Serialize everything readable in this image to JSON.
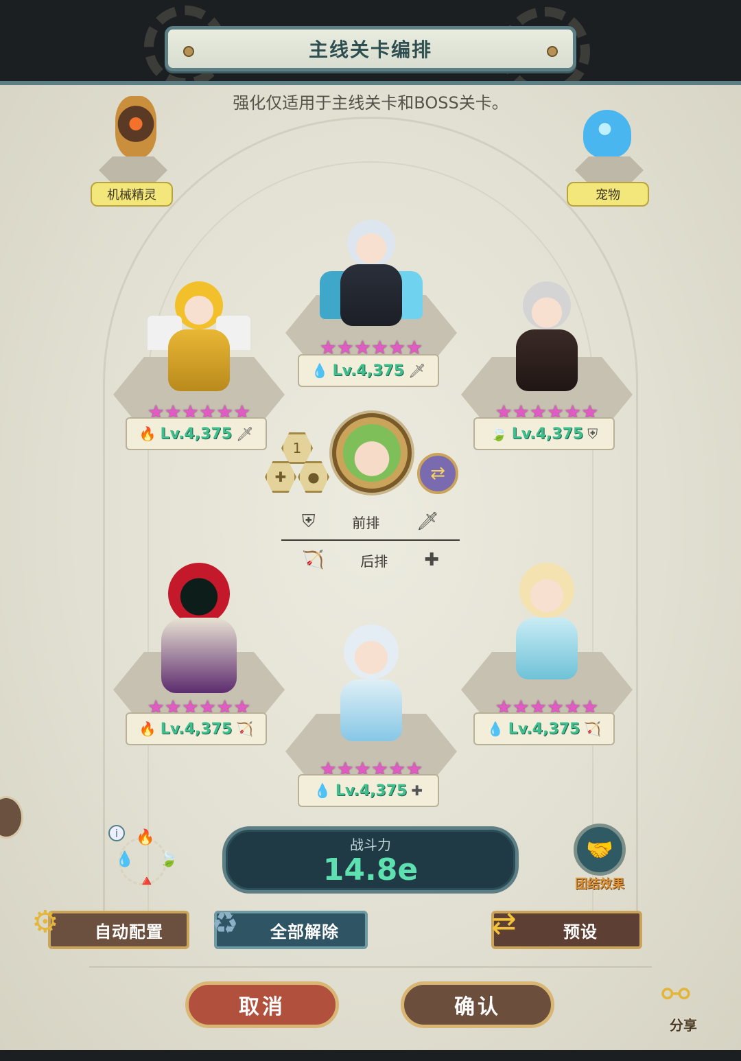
{
  "header": {
    "title": "主线关卡编排"
  },
  "subtitle": "强化仅适用于主线关卡和BOSS关卡。",
  "side_slots": {
    "mech_label": "机械精灵",
    "pet_label": "宠物"
  },
  "heroes": {
    "top_center": {
      "stars": "★★★★★★",
      "element": "💧",
      "level": "Lv.4,375",
      "role_icon": "sword-icon",
      "role": "🗡"
    },
    "front_left": {
      "stars": "★★★★★★",
      "element": "🔥",
      "level": "Lv.4,375",
      "role_icon": "sword-icon",
      "role": "🗡"
    },
    "front_right": {
      "stars": "★★★★★★",
      "element": "🍃",
      "level": "Lv.4,375",
      "role_icon": "shield-icon",
      "role": "⛨"
    },
    "back_left": {
      "stars": "★★★★★★",
      "element": "🔥",
      "level": "Lv.4,375",
      "role_icon": "crossbow-icon",
      "role": "🏹"
    },
    "back_right": {
      "stars": "★★★★★★",
      "element": "💧",
      "level": "Lv.4,375",
      "role_icon": "crossbow-icon",
      "role": "🏹"
    },
    "bottom_center": {
      "stars": "★★★★★★",
      "element": "💧",
      "level": "Lv.4,375",
      "role_icon": "plus-icon",
      "role": "✚"
    }
  },
  "leader": {
    "badge": "1",
    "plus": "✚",
    "orb": "●",
    "swap": "⇄"
  },
  "rows": {
    "front_label": "前排",
    "front_left_icon": "⛨",
    "front_right_icon": "🗡",
    "back_label": "后排",
    "back_left_icon": "🏹",
    "back_right_icon": "✚"
  },
  "power": {
    "label": "战斗力",
    "value": "14.8e"
  },
  "union": {
    "label": "团结效果",
    "icon": "🤝"
  },
  "elements": {
    "fire": "🔥",
    "leaf": "🍃",
    "water": "💧",
    "light": "🔺",
    "info": "i"
  },
  "buttons": {
    "auto": "自动配置",
    "clear": "全部解除",
    "preset": "预设",
    "cancel": "取消",
    "confirm": "确认",
    "share": "分享",
    "auto_icon": "⚙",
    "clear_icon": "♻",
    "preset_icon": "⇄",
    "share_icon": "⚯"
  },
  "colors": {
    "frame": "#5b7f84",
    "level_text": "#3fbe8e",
    "star": "#e05bc4",
    "power_value": "#5fe0b0",
    "union_label": "#d9933a"
  }
}
